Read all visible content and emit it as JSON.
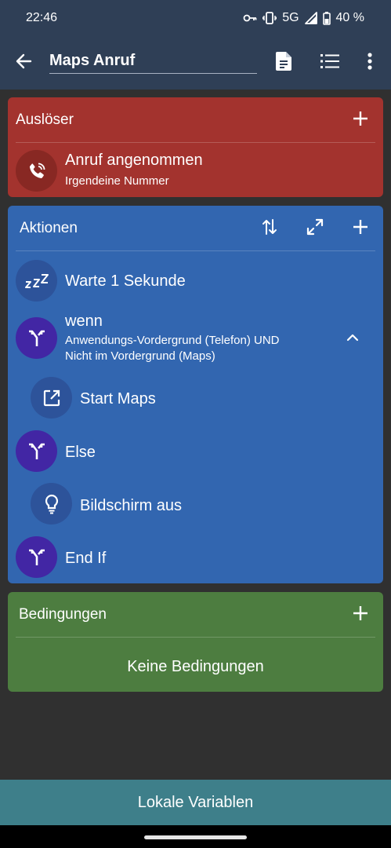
{
  "status_bar": {
    "time": "22:46",
    "network": "5G",
    "battery": "40 %",
    "icons": [
      "key-icon",
      "vibrate-icon",
      "signal-icon",
      "battery-icon"
    ]
  },
  "app_bar": {
    "title": "Maps Anruf",
    "icons": [
      "back-arrow-icon",
      "document-icon",
      "list-icon",
      "more-vert-icon"
    ]
  },
  "trigger_card": {
    "title": "Auslöser",
    "color": "#a3332e",
    "item": {
      "icon": "phone-call-icon",
      "label": "Anruf angenommen",
      "sub": "Irgendeine Nummer"
    }
  },
  "actions_card": {
    "title": "Aktionen",
    "color": "#3266b0",
    "items": [
      {
        "icon": "sleep-zzz-icon",
        "label": "Warte 1 Sekunde"
      },
      {
        "icon": "fork-icon",
        "label": "wenn",
        "sub_line1": "Anwendungs-Vordergrund (Telefon) UND",
        "sub_line2": "Nicht im Vordergrund (Maps)"
      },
      {
        "icon": "open-external-icon",
        "label": "Start Maps"
      },
      {
        "icon": "fork-icon",
        "label": "Else"
      },
      {
        "icon": "lightbulb-icon",
        "label": "Bildschirm aus"
      },
      {
        "icon": "fork-icon",
        "label": "End If"
      }
    ]
  },
  "conditions_card": {
    "title": "Bedingungen",
    "color": "#4d7d40",
    "empty_text": "Keine Bedingungen"
  },
  "bottom_button": {
    "label": "Lokale Variablen",
    "color": "#3e7f8a"
  }
}
